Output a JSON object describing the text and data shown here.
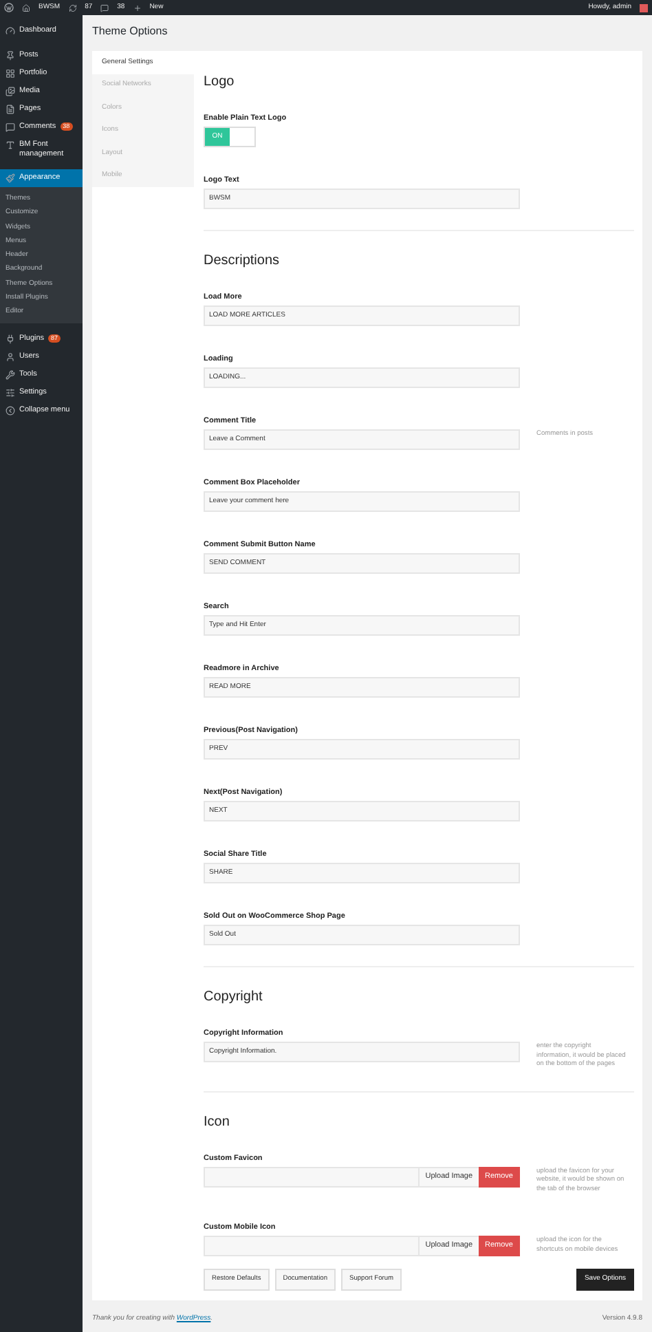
{
  "admin_bar": {
    "site": "BWSM",
    "updates": "87",
    "comments": "38",
    "new": "New",
    "greeting": "Howdy, admin"
  },
  "sidebar": {
    "items": [
      {
        "label": "Dashboard",
        "selected": false
      },
      {
        "label": "Posts",
        "selected": false
      },
      {
        "label": "Portfolio",
        "selected": false
      },
      {
        "label": "Media",
        "selected": false
      },
      {
        "label": "Pages",
        "selected": false
      },
      {
        "label": "Comments",
        "badge": "38",
        "selected": false
      },
      {
        "label": "BM Font management",
        "selected": false
      },
      {
        "label": "Appearance",
        "selected": true,
        "children": [
          {
            "label": "Themes",
            "selected": false
          },
          {
            "label": "Customize",
            "selected": false
          },
          {
            "label": "Widgets",
            "selected": false
          },
          {
            "label": "Menus",
            "selected": false
          },
          {
            "label": "Header",
            "selected": false
          },
          {
            "label": "Background",
            "selected": false
          },
          {
            "label": "Theme Options",
            "selected": false
          },
          {
            "label": "Install Plugins",
            "selected": false
          },
          {
            "label": "Editor",
            "selected": false
          }
        ]
      },
      {
        "label": "Plugins",
        "badge": "87",
        "selected": false
      },
      {
        "label": "Users",
        "selected": false
      },
      {
        "label": "Tools",
        "selected": false
      },
      {
        "label": "Settings",
        "selected": false
      },
      {
        "label": "Collapse menu",
        "selected": false
      }
    ]
  },
  "page_title": "Theme Options",
  "tabs": [
    {
      "label": "General Settings",
      "selected": true
    },
    {
      "label": "Social Networks",
      "selected": false
    },
    {
      "label": "Colors",
      "selected": false
    },
    {
      "label": "Icons",
      "selected": false
    },
    {
      "label": "Layout",
      "selected": false
    },
    {
      "label": "Mobile",
      "selected": false
    }
  ],
  "sections": [
    {
      "title": "Logo",
      "fields": [
        {
          "kind": "toggle",
          "label": "Enable Plain Text Logo",
          "on": true,
          "on_label": "ON"
        },
        {
          "kind": "text",
          "label": "Logo Text",
          "value": "BWSM"
        }
      ]
    },
    {
      "title": "Descriptions",
      "fields": [
        {
          "kind": "text",
          "label": "Load More",
          "value": "LOAD MORE ARTICLES"
        },
        {
          "kind": "text",
          "label": "Loading",
          "value": "LOADING..."
        },
        {
          "kind": "text",
          "label": "Comment Title",
          "value": "Leave a Comment",
          "description": "Comments in posts"
        },
        {
          "kind": "text",
          "label": "Comment Box Placeholder",
          "value": "Leave your comment here"
        },
        {
          "kind": "text",
          "label": "Comment Submit Button Name",
          "value": "SEND COMMENT"
        },
        {
          "kind": "text",
          "label": "Search",
          "value": "Type and Hit Enter"
        },
        {
          "kind": "text",
          "label": "Readmore in Archive",
          "value": "READ MORE"
        },
        {
          "kind": "text",
          "label": "Previous(Post Navigation)",
          "value": "PREV"
        },
        {
          "kind": "text",
          "label": "Next(Post Navigation)",
          "value": "NEXT"
        },
        {
          "kind": "text",
          "label": "Social Share Title",
          "value": "SHARE"
        },
        {
          "kind": "text",
          "label": "Sold Out on WooCommerce Shop Page",
          "value": "Sold Out"
        }
      ]
    },
    {
      "title": "Copyright",
      "fields": [
        {
          "kind": "text",
          "label": "Copyright Information",
          "value": "Copyright Information.",
          "description": "enter the copyright information, it would be placed on the bottom of the pages"
        }
      ]
    },
    {
      "title": "Icon",
      "fields": [
        {
          "kind": "upload",
          "label": "Custom Favicon",
          "upload": "Upload Image",
          "remove": "Remove",
          "description": "upload the favicon for your website, it would be shown on the tab of the browser"
        },
        {
          "kind": "upload",
          "label": "Custom Mobile Icon",
          "upload": "Upload Image",
          "remove": "Remove",
          "description": "upload the icon for the shortcuts on mobile devices"
        }
      ]
    }
  ],
  "buttons": [
    "Restore Defaults",
    "Documentation",
    "Support Forum"
  ],
  "save_button": "Save Options",
  "footer": {
    "text": "Thank you for creating with ",
    "link": "WordPress",
    "after": ".",
    "version": "Version 4.9.8"
  }
}
